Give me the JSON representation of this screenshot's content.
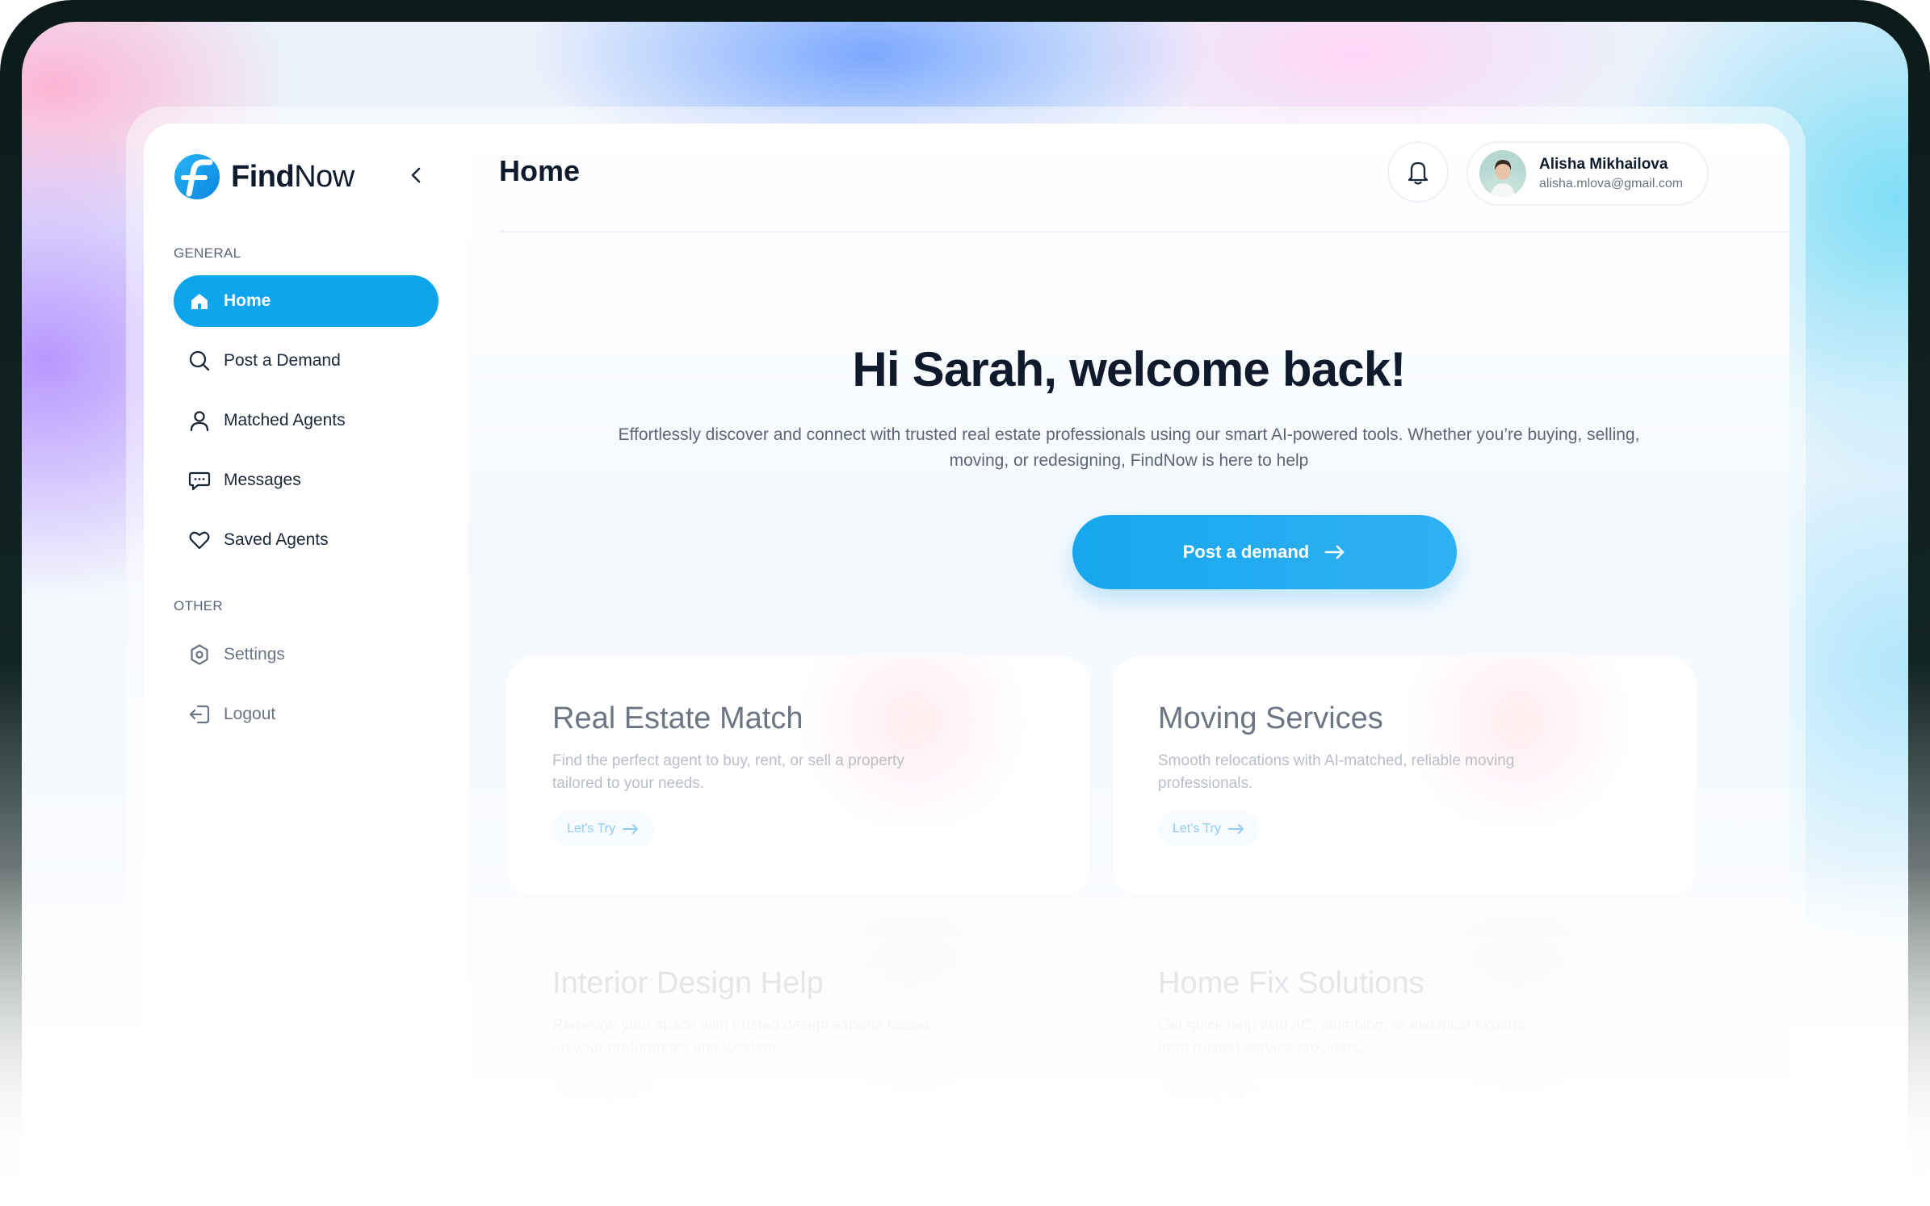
{
  "brand": {
    "name_bold": "Find",
    "name_light": "Now",
    "accent": "#0ea5ec"
  },
  "sidebar": {
    "general_label": "GENERAL",
    "other_label": "OTHER",
    "items": [
      {
        "label": "Home",
        "icon": "home-icon",
        "active": true
      },
      {
        "label": "Post a Demand",
        "icon": "search-icon"
      },
      {
        "label": "Matched Agents",
        "icon": "user-icon"
      },
      {
        "label": "Messages",
        "icon": "chat-icon"
      },
      {
        "label": "Saved Agents",
        "icon": "heart-icon"
      }
    ],
    "other_items": [
      {
        "label": "Settings",
        "icon": "settings-icon"
      },
      {
        "label": "Logout",
        "icon": "logout-icon"
      }
    ]
  },
  "header": {
    "title": "Home",
    "user": {
      "name": "Alisha Mikhailova",
      "email": "alisha.mlova@gmail.com"
    }
  },
  "hero": {
    "title": "Hi Sarah, welcome back!",
    "subtitle": "Effortlessly discover and connect with trusted real estate professionals using our smart AI-powered tools. Whether you’re buying, selling, moving, or redesigning, FindNow is here to help",
    "cta_label": "Post a demand"
  },
  "cards": [
    {
      "title": "Real Estate Match",
      "desc": "Find the perfect agent to buy, rent, or sell a property tailored to your needs.",
      "button": "Let's Try"
    },
    {
      "title": "Moving Services",
      "desc": "Smooth relocations with AI-matched, reliable moving professionals.",
      "button": "Let's Try"
    },
    {
      "title": "Interior Design Help",
      "desc": "Redesign your space with trusted design experts based on your preferences and location.",
      "button": "Let's Try"
    },
    {
      "title": "Home Fix Solutions",
      "desc": "Get quick help with AC, plumbing, or electrical experts from trusted service providers.",
      "button": "Let's Try"
    }
  ]
}
